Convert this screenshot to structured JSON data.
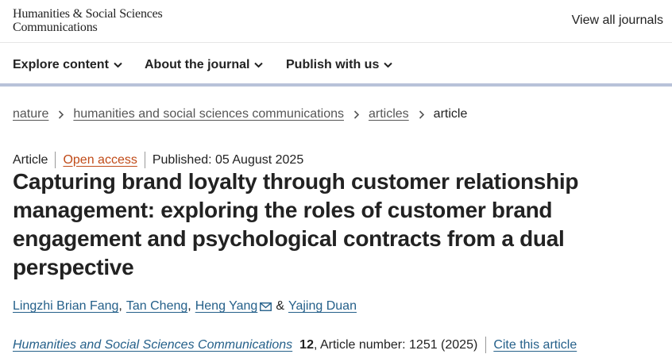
{
  "header": {
    "logo_line1": "Humanities & Social Sciences",
    "logo_line2": "Communications",
    "view_all": "View all journals"
  },
  "nav": {
    "items": [
      {
        "label": "Explore content",
        "icon": "chevron-down-icon"
      },
      {
        "label": "About the journal",
        "icon": "chevron-down-icon"
      },
      {
        "label": "Publish with us",
        "icon": "chevron-down-icon"
      }
    ]
  },
  "breadcrumb": {
    "items": [
      "nature",
      "humanities and social sciences communications",
      "articles"
    ],
    "current": "article"
  },
  "article": {
    "type": "Article",
    "access": "Open access",
    "published": "Published: 05 August 2025",
    "title": "Capturing brand loyalty through customer relationship management: exploring the roles of customer brand engagement and psychological contracts from a dual perspective",
    "authors": [
      "Lingzhi Brian Fang",
      "Tan Cheng",
      "Heng Yang",
      "Yajing Duan"
    ],
    "author_sep": ",",
    "author_amp": "&",
    "journal": "Humanities and Social Sciences Communications",
    "volume": "12",
    "article_number": ", Article number: 1251 (2025)",
    "cite": "Cite this article"
  },
  "colors": {
    "link": "#25608a",
    "open_access": "#c04a17",
    "nav_border": "#b8c2d9"
  }
}
